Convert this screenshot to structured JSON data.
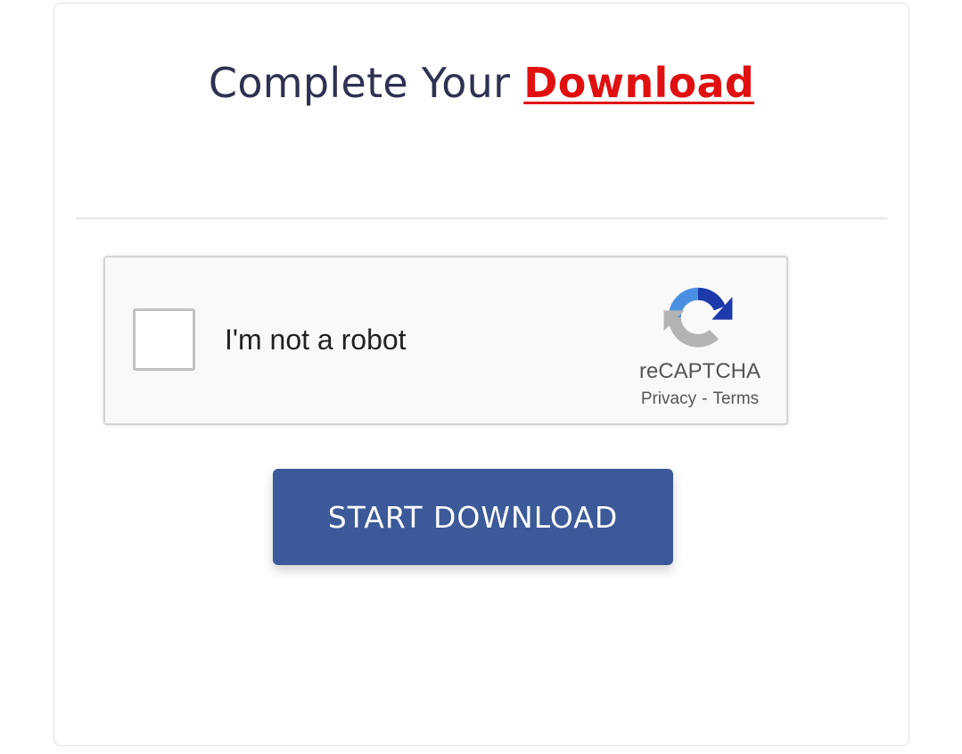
{
  "header": {
    "title_prefix": "Complete Your",
    "title_highlight": "Download"
  },
  "captcha": {
    "checkbox_label": "I'm not a robot",
    "checked": false,
    "brand": "reCAPTCHA",
    "privacy_link": "Privacy",
    "separator": "-",
    "terms_link": "Terms",
    "logo_icon": "recaptcha-logo-icon"
  },
  "actions": {
    "start_label": "START DOWNLOAD"
  },
  "colors": {
    "title_text": "#2f3152",
    "highlight": "#e01010",
    "button_bg": "#3c5a99",
    "button_text": "#ffffff",
    "captcha_bg": "#f9f9f9",
    "recaptcha_dark_blue": "#1c3aa9",
    "recaptcha_light_blue": "#4a90e2",
    "recaptcha_gray": "#b3b3b3"
  }
}
